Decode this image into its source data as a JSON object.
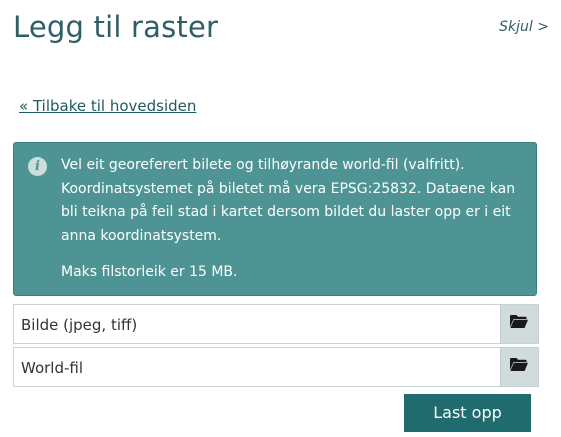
{
  "header": {
    "title": "Legg til raster",
    "hide_label": "Skjul >"
  },
  "back_link": "« Tilbake til hovedsiden",
  "info": {
    "icon": "info-icon",
    "text": "Vel eit georeferert bilete og tilhøyrande world-fil (valfritt). Koordinatsystemet på biletet må vera EPSG:25832. Dataene kan bli teikna på feil stad i kartet dersom bildet du laster opp er i eit anna koordinatsystem.",
    "max_size": "Maks filstorleik er 15 MB.",
    "background_color": "#4f9494"
  },
  "file_inputs": [
    {
      "label": "Bilde (jpeg, tiff)",
      "icon": "folder-icon"
    },
    {
      "label": "World-fil",
      "icon": "folder-icon"
    }
  ],
  "upload_button": {
    "label": "Last opp",
    "color": "#1f6b6d"
  }
}
